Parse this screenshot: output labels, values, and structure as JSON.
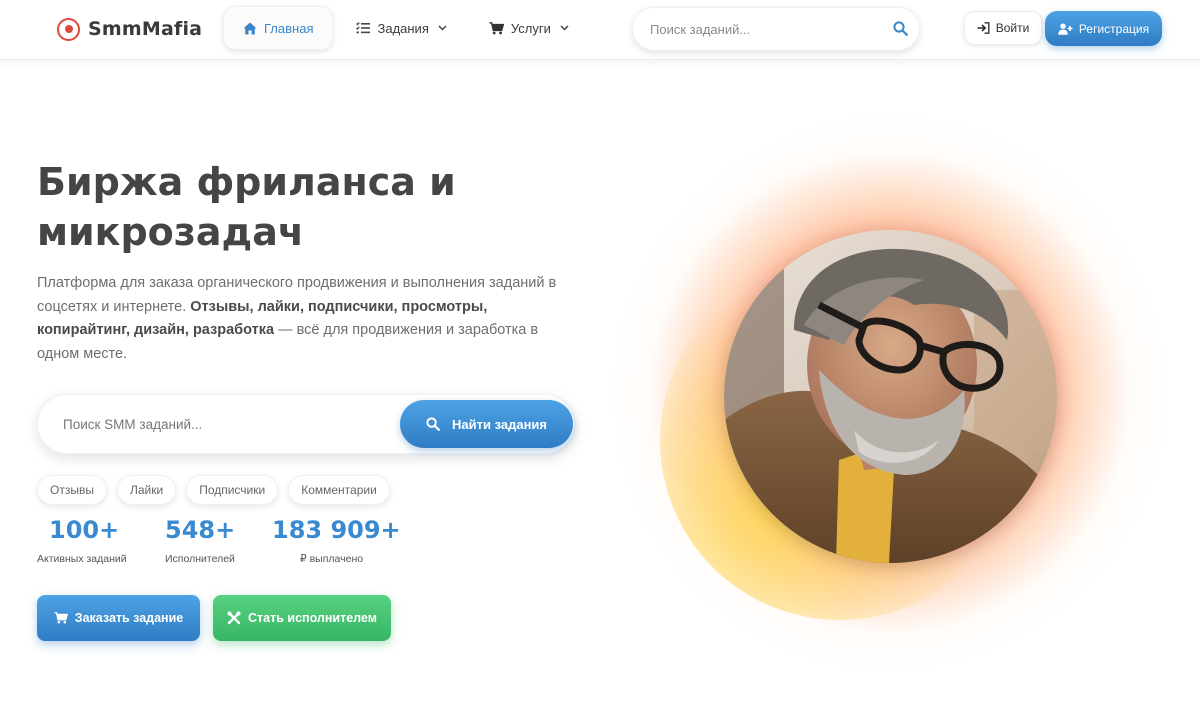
{
  "brand": {
    "name": "SmmMafia",
    "accent": "#e0473b"
  },
  "nav": {
    "items": [
      {
        "label": "Главная",
        "icon": "home-icon",
        "active": true
      },
      {
        "label": "Задания",
        "icon": "list-icon",
        "dropdown": true
      },
      {
        "label": "Услуги",
        "icon": "cart-icon",
        "dropdown": true
      }
    ]
  },
  "header_search": {
    "placeholder": "Поиск заданий...",
    "icon": "search-icon"
  },
  "auth": {
    "login_label": "Войти",
    "register_label": "Регистрация"
  },
  "hero": {
    "title": "Биржа фриланса и микрозадач",
    "desc_intro": "Платформа для заказа органического продвижения и выполнения заданий в соцсетях и интернете. ",
    "desc_bold": "Отзывы, лайки, подписчики, просмотры, копирайтинг, дизайн, разработка",
    "desc_tail": " — всё для продвижения и заработка в одном месте.",
    "search_placeholder": "Поиск SMM заданий...",
    "search_button": "Найти задания",
    "chips": [
      "Отзывы",
      "Лайки",
      "Подписчики",
      "Комментарии"
    ],
    "stats": [
      {
        "value": "100+",
        "label": "Активных заданий"
      },
      {
        "value": "548+",
        "label": "Исполнителей"
      },
      {
        "value": "183 909+",
        "label": "₽ выплачено"
      }
    ],
    "order_button": "Заказать задание",
    "worker_button": "Стать исполнителем"
  },
  "colors": {
    "primary": "#3a86c8",
    "primary_gradient": [
      "#4ea3e4",
      "#2f7cc4"
    ],
    "success_gradient": [
      "#57d17f",
      "#37b565"
    ],
    "stat_number": "#3a8ad0"
  }
}
